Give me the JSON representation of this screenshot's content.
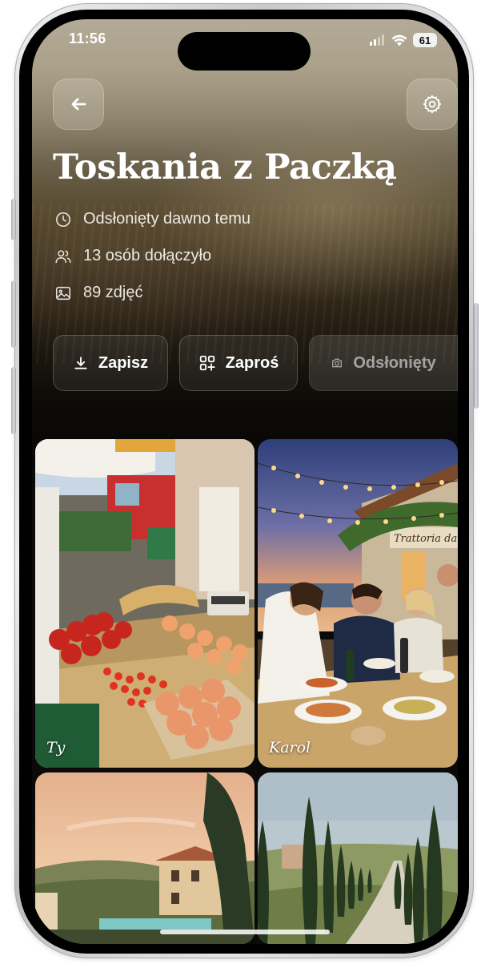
{
  "status_bar": {
    "time": "11:56",
    "battery": "61"
  },
  "album": {
    "title": "Toskania z Paczką",
    "meta": [
      {
        "icon": "clock-icon",
        "text": "Odsłonięty dawno temu"
      },
      {
        "icon": "people-icon",
        "text": "13 osób dołączyło"
      },
      {
        "icon": "image-icon",
        "text": "89 zdjęć"
      }
    ]
  },
  "actions": {
    "save_label": "Zapisz",
    "invite_label": "Zaproś",
    "revealed_label": "Odsłonięty"
  },
  "photos": [
    {
      "author": "Ty",
      "subject": "market"
    },
    {
      "author": "Karol",
      "subject": "trattoria"
    },
    {
      "author": "",
      "subject": "villa"
    },
    {
      "author": "",
      "subject": "cypress-road"
    }
  ],
  "trattoria_sign": "Trattoria da M"
}
